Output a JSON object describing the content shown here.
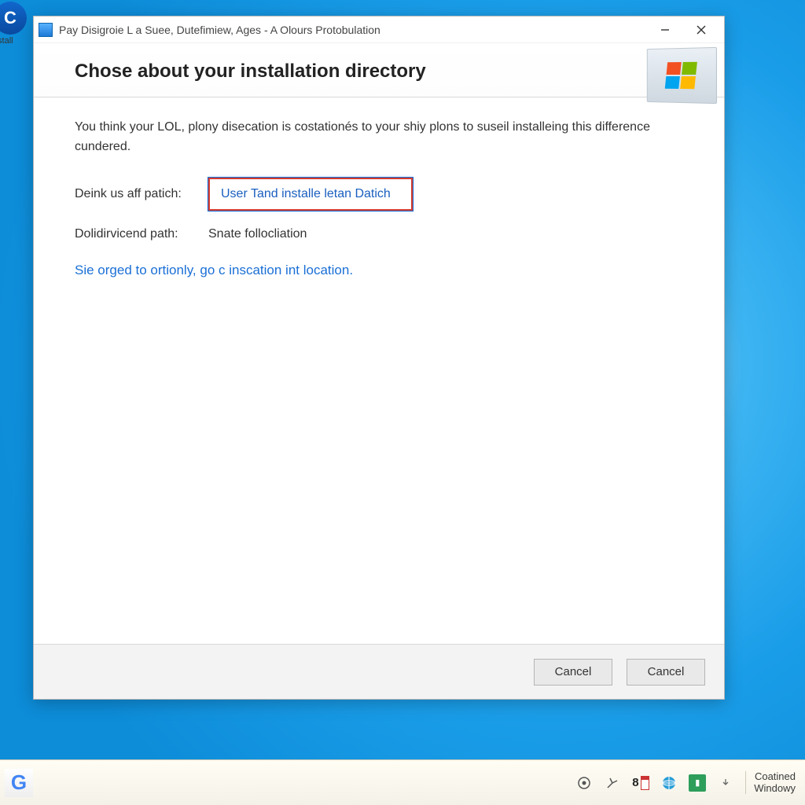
{
  "desktop": {
    "side_app_label": "ıstall"
  },
  "window": {
    "title": "Pay Disigroie L a Suee, Dutefimiew, Ages - A Olours Protobulation",
    "header_heading": "Chose about your installation directory",
    "description": "You think your LOL, plony disecation is costationés to your shiy plons to suseil installeing this difference cundered.",
    "row1_label": "Deink us aff patich:",
    "row1_field": "User Tand installe letan Datich",
    "row2_label": "Dolidirvicend path:",
    "row2_value": "Snate follocliation",
    "link_text": "Sie orged to ortionly, go c inscation int location.",
    "footer": {
      "btn1": "Cancel",
      "btn2": "Cancel"
    }
  },
  "taskbar": {
    "day_number": "8",
    "clock_line1": "Coatined",
    "clock_line2": "Windowy"
  }
}
